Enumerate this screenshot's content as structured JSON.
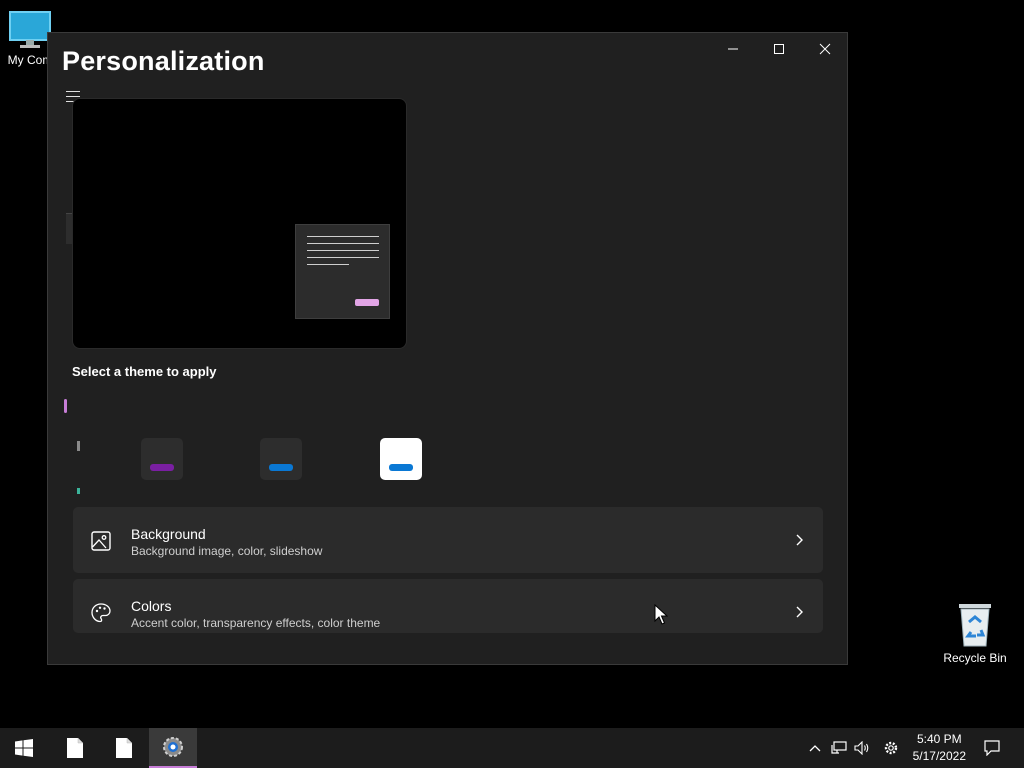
{
  "desktop": {
    "icons": [
      {
        "label": "My Com",
        "icon": "computer-icon"
      },
      {
        "label": "Recycle Bin",
        "icon": "recycle-bin-icon"
      }
    ]
  },
  "window": {
    "title": "Personalization",
    "controls": {
      "minimize": "minimize-icon",
      "maximize": "maximize-icon",
      "close": "close-icon"
    },
    "menu_icon": "hamburger-icon",
    "theme_section_label": "Select a theme to apply",
    "themes": [
      {
        "name": "dark-purple",
        "tile_color": "#2d2d2d",
        "accent": "#7a1fa2"
      },
      {
        "name": "dark-blue",
        "tile_color": "#2d2d2d",
        "accent": "#0a78d4"
      },
      {
        "name": "light",
        "tile_color": "#ffffff",
        "accent": "#0a78d4"
      }
    ],
    "settings": [
      {
        "title": "Background",
        "subtitle": "Background image, color, slideshow",
        "icon": "image-icon"
      },
      {
        "title": "Colors",
        "subtitle": "Accent color, transparency effects, color theme",
        "icon": "palette-icon"
      }
    ]
  },
  "taskbar": {
    "time": "5:40 PM",
    "date": "5/17/2022",
    "items": [
      "start-icon",
      "file-icon",
      "file-icon",
      "settings-app-icon"
    ],
    "tray": [
      "chevron-up-icon",
      "network-icon",
      "volume-icon",
      "gear-icon",
      "notification-icon"
    ]
  },
  "colors": {
    "accent": "#c77dd7",
    "window_bg": "#202020",
    "row_bg": "#2b2b2b"
  }
}
